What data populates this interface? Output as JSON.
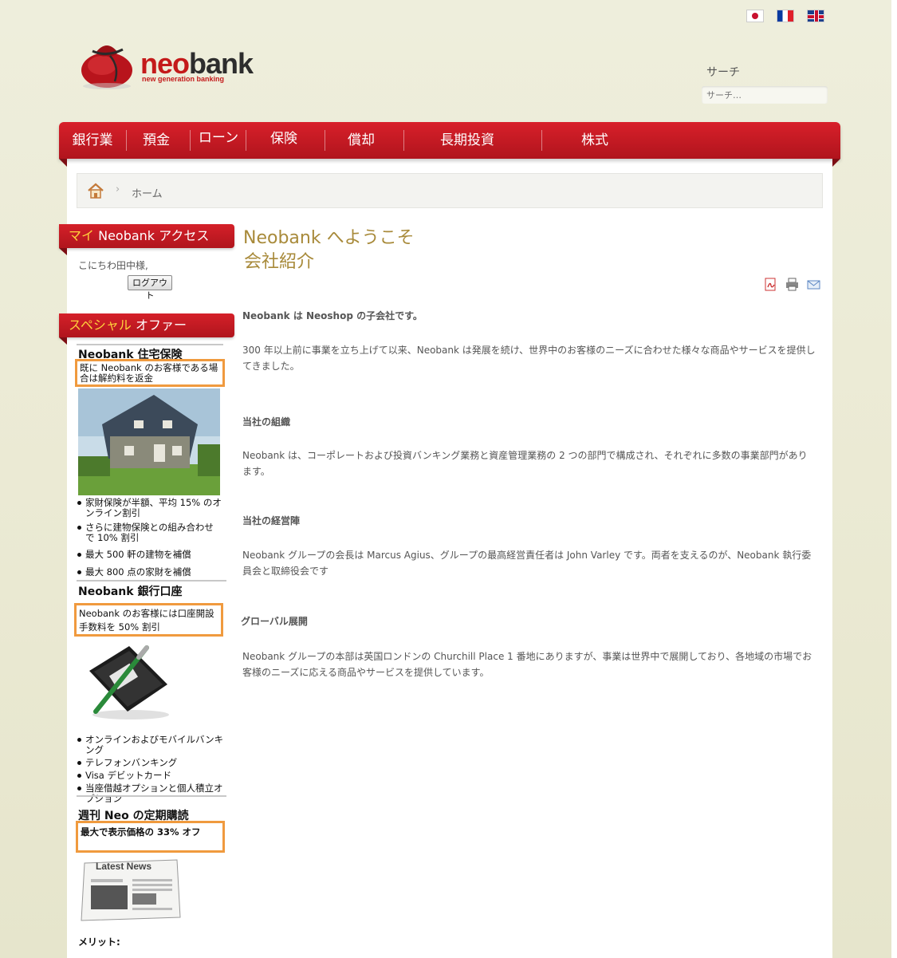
{
  "header": {
    "brand_neo": "neo",
    "brand_bank": "bank",
    "tagline": "new generation banking",
    "languages": [
      "日本語",
      "Français",
      "English"
    ],
    "search": {
      "label": "サーチ",
      "placeholder": "サーチ…"
    }
  },
  "nav": {
    "items": [
      "銀行業",
      "預金",
      "ローン",
      "保険",
      "償却",
      "長期投資",
      "株式"
    ]
  },
  "breadcrumb": {
    "home": "ホーム"
  },
  "sidebar": {
    "access": {
      "title_highlight": "マイ",
      "title_rest": " Neobank アクセス",
      "greeting": "こにちわ田中様,",
      "logout_label": "ログアウト"
    },
    "special": {
      "title_highlight": "スペシャル",
      "title_rest": " オファー"
    },
    "offers": [
      {
        "title": "Neobank 住宅保険",
        "highlight": "既に Neobank のお客様である場合は解約料を返金",
        "bullets": [
          "家財保険が半額、平均 15% のオンライン割引",
          "さらに建物保険との組み合わせで 10% 割引",
          "最大 500 軒の建物を補償",
          "最大 800 点の家財を補償"
        ]
      },
      {
        "title": "Neobank 銀行口座",
        "highlight": "Neobank のお客様には口座開設手数料を 50% 割引",
        "bullets": [
          "オンラインおよびモバイルバンキング",
          "テレフォンバンキング",
          "Visa デビットカード",
          "当座借越オプションと個人積立オプション"
        ]
      },
      {
        "title": "週刊 Neo の定期購読",
        "highlight": "最大で表示価格の 33% オフ",
        "image_text": "Latest News",
        "merit_label": "メリット:"
      }
    ]
  },
  "content": {
    "title": "Neobank へようこそ",
    "subtitle": "会社紹介",
    "intro": "Neobank は Neoshop の子会社です。",
    "para1": "300 年以上前に事業を立ち上げて以来、Neobank は発展を続け、世界中のお客様のニーズに合わせた様々な商品やサービスを提供してきました。",
    "section_org": "当社の組織",
    "para_org": "Neobank は、コーポレートおよび投資バンキング業務と資産管理業務の 2 つの部門で構成され、それぞれに多数の事業部門があります。",
    "section_mgmt": "当社の経営陣",
    "para_mgmt": "Neobank グループの会長は Marcus Agius、グループの最高経営責任者は John Varley です。両者を支えるのが、Neobank 執行委員会と取締役会です",
    "section_global": "グローバル展開",
    "para_global": "Neobank グループの本部は英国ロンドンの Churchill Place 1 番地にありますが、事業は世界中で展開しており、各地域の市場でお客様のニーズに応える商品やサービスを提供しています。"
  },
  "colors": {
    "nav_red": "#c41a1a",
    "title_gold": "#a88a3a",
    "offer_border": "#f09a3e",
    "highlight_yellow": "#ffd23c"
  }
}
